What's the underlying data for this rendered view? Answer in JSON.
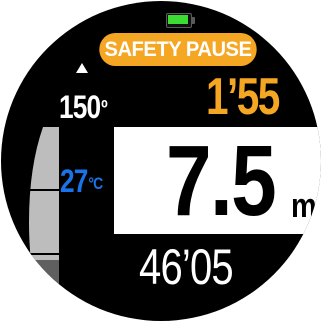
{
  "battery": {
    "level": 0.9,
    "color": "#3ddc34"
  },
  "status": {
    "label": "SAFETY PAUSE",
    "color": "#f5a623"
  },
  "heading": {
    "value": "150",
    "unit": "º",
    "indicator_icon": "triangle-up-icon"
  },
  "safety_stop_timer": {
    "value": "1’55",
    "color": "#f5a623"
  },
  "temperature": {
    "value": "27",
    "unit": "°C",
    "color": "#1a73e8"
  },
  "depth": {
    "value": "7.5",
    "unit": "m"
  },
  "dive_time": {
    "value": "46’05"
  },
  "ascent_gauge": {
    "level": 0.3,
    "segments": 3
  }
}
